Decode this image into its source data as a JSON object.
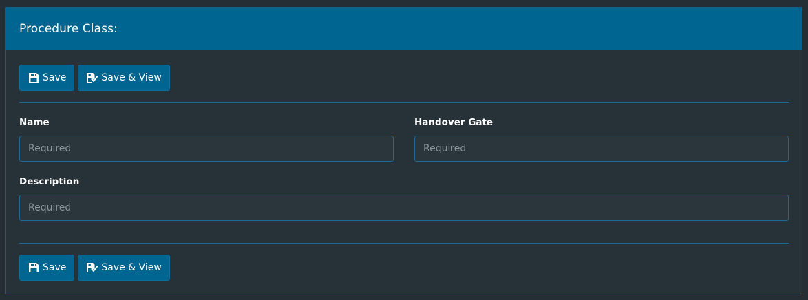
{
  "panel": {
    "title": "Procedure Class:"
  },
  "toolbar_top": {
    "save_label": "Save",
    "save_view_label": "Save & View"
  },
  "toolbar_bottom": {
    "save_label": "Save",
    "save_view_label": "Save & View"
  },
  "form": {
    "name": {
      "label": "Name",
      "value": "",
      "placeholder": "Required"
    },
    "handover_gate": {
      "label": "Handover Gate",
      "value": "",
      "placeholder": "Required"
    },
    "description": {
      "label": "Description",
      "value": "",
      "placeholder": "Required"
    }
  },
  "colors": {
    "page_background": "#252e35",
    "panel_background": "#263238",
    "header_background": "#006590",
    "button_background": "#006590",
    "border_accent": "#1f6a94",
    "input_background": "#2b353c",
    "placeholder_text": "#8b969c"
  },
  "icons": {
    "save": "floppy-disk-icon",
    "save_view": "floppy-disk-check-icon"
  }
}
